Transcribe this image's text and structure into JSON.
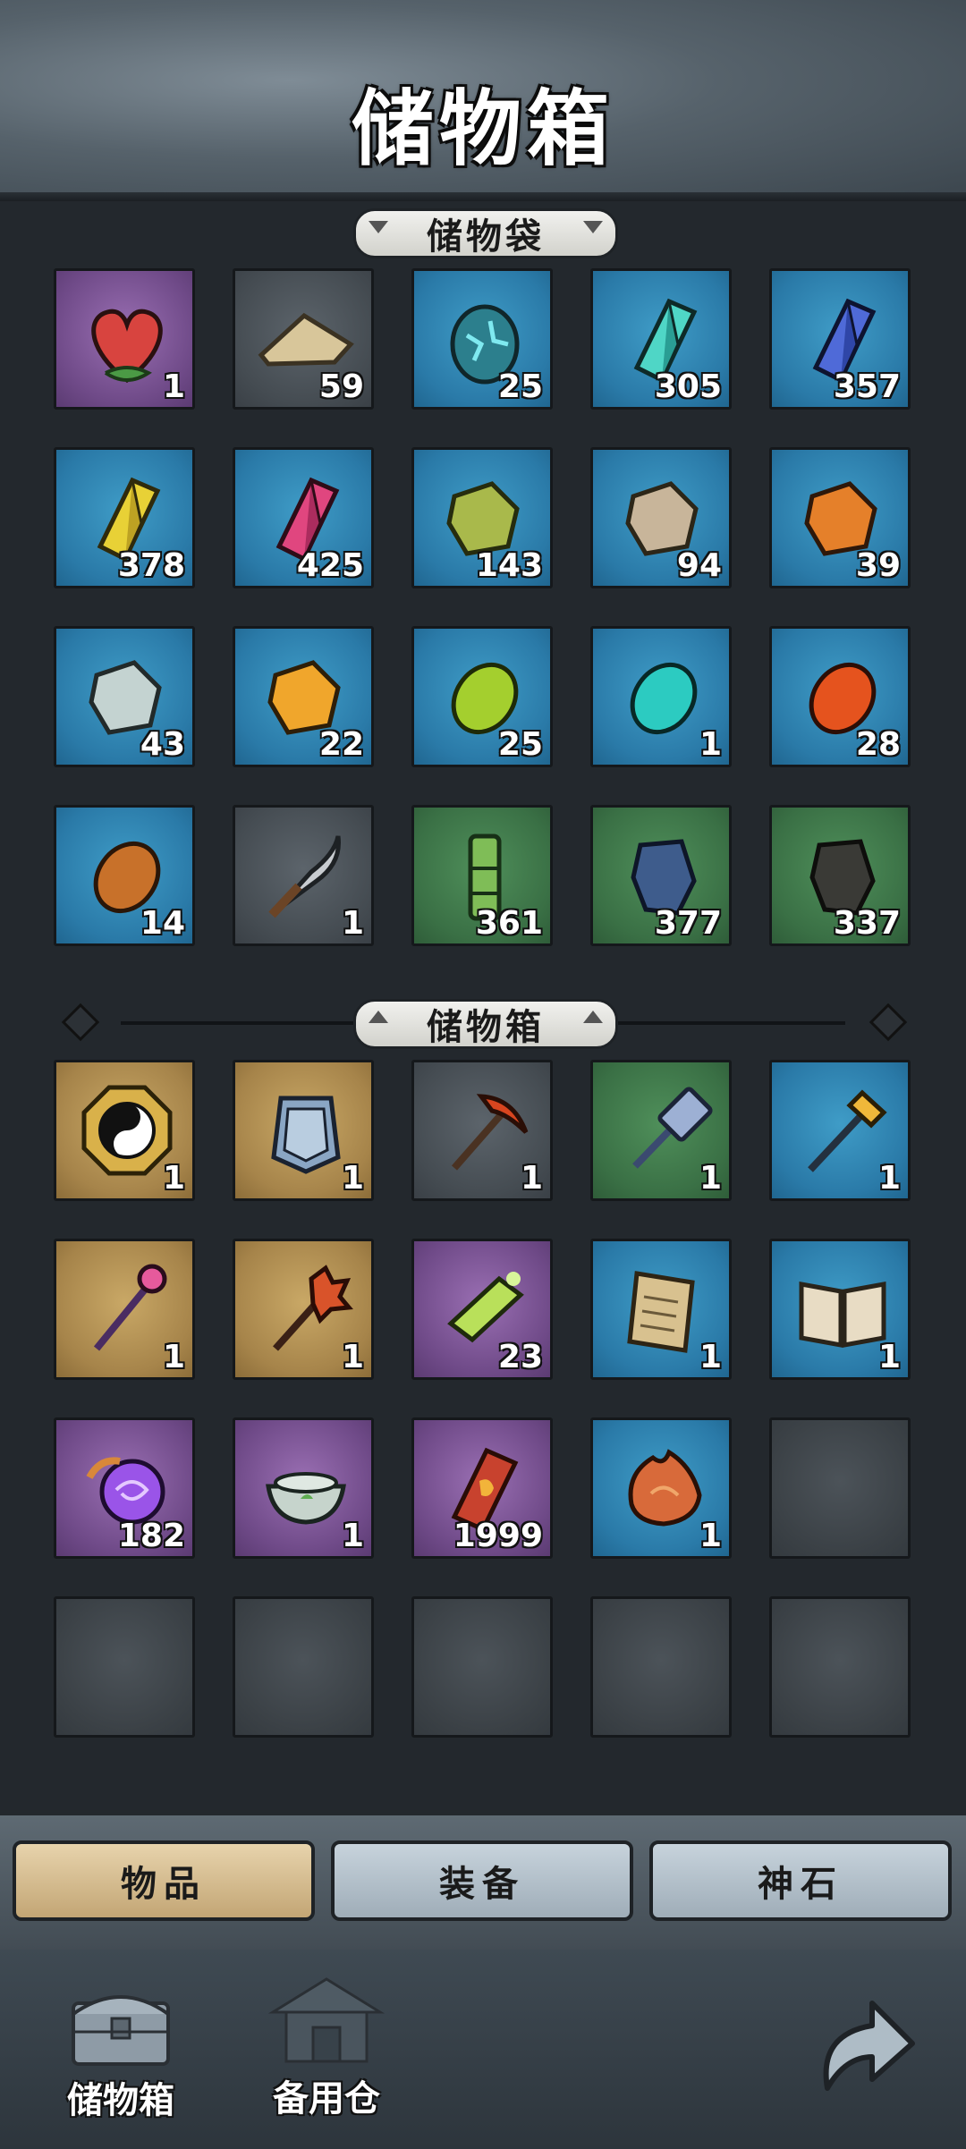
{
  "header": {
    "title": "储物箱"
  },
  "bag_section": {
    "title": "储物袋",
    "items": [
      {
        "icon": "heart-fruit-icon",
        "rarity": "purple",
        "count": "1"
      },
      {
        "icon": "sand-pile-icon",
        "rarity": "gray",
        "count": "59"
      },
      {
        "icon": "cracked-gem-icon",
        "rarity": "blue",
        "count": "25"
      },
      {
        "icon": "cyan-crystal-icon",
        "rarity": "blue",
        "count": "305"
      },
      {
        "icon": "blue-crystal-icon",
        "rarity": "blue",
        "count": "357"
      },
      {
        "icon": "yellow-crystal-icon",
        "rarity": "blue",
        "count": "378"
      },
      {
        "icon": "pink-crystal-icon",
        "rarity": "blue",
        "count": "425"
      },
      {
        "icon": "olive-ore-icon",
        "rarity": "blue",
        "count": "143"
      },
      {
        "icon": "beige-ore-icon",
        "rarity": "blue",
        "count": "94"
      },
      {
        "icon": "orange-ore-icon",
        "rarity": "blue",
        "count": "39"
      },
      {
        "icon": "white-ore-icon",
        "rarity": "blue",
        "count": "43"
      },
      {
        "icon": "amber-ore-icon",
        "rarity": "blue",
        "count": "22"
      },
      {
        "icon": "green-pebble-icon",
        "rarity": "blue",
        "count": "25"
      },
      {
        "icon": "teal-pebble-icon",
        "rarity": "blue",
        "count": "1"
      },
      {
        "icon": "red-pebble-icon",
        "rarity": "blue",
        "count": "28"
      },
      {
        "icon": "brown-pebble-icon",
        "rarity": "blue",
        "count": "14"
      },
      {
        "icon": "sickle-icon",
        "rarity": "gray",
        "count": "1"
      },
      {
        "icon": "bamboo-icon",
        "rarity": "green",
        "count": "361"
      },
      {
        "icon": "dark-blue-stone-icon",
        "rarity": "green",
        "count": "377"
      },
      {
        "icon": "black-stone-icon",
        "rarity": "green",
        "count": "337"
      }
    ]
  },
  "box_section": {
    "title": "储物箱",
    "items": [
      {
        "icon": "yin-yang-medallion-icon",
        "rarity": "gold",
        "count": "1"
      },
      {
        "icon": "armor-icon",
        "rarity": "gold",
        "count": "1"
      },
      {
        "icon": "pickaxe-icon",
        "rarity": "gray",
        "count": "1"
      },
      {
        "icon": "hammer-icon",
        "rarity": "green",
        "count": "1"
      },
      {
        "icon": "golden-mace-icon",
        "rarity": "blue",
        "count": "1"
      },
      {
        "icon": "staff-icon",
        "rarity": "gold",
        "count": "1"
      },
      {
        "icon": "fire-mace-icon",
        "rarity": "gold",
        "count": "1"
      },
      {
        "icon": "green-scroll-icon",
        "rarity": "purple",
        "count": "23"
      },
      {
        "icon": "parchment-icon",
        "rarity": "blue",
        "count": "1"
      },
      {
        "icon": "book-icon",
        "rarity": "blue",
        "count": "1"
      },
      {
        "icon": "purple-orb-icon",
        "rarity": "purple",
        "count": "182"
      },
      {
        "icon": "tea-bowl-icon",
        "rarity": "purple",
        "count": "1"
      },
      {
        "icon": "talisman-icon",
        "rarity": "purple",
        "count": "1999"
      },
      {
        "icon": "flame-pelt-icon",
        "rarity": "blue",
        "count": "1"
      },
      {
        "icon": "",
        "rarity": "empty",
        "count": ""
      },
      {
        "icon": "",
        "rarity": "empty",
        "count": ""
      },
      {
        "icon": "",
        "rarity": "empty",
        "count": ""
      },
      {
        "icon": "",
        "rarity": "empty",
        "count": ""
      },
      {
        "icon": "",
        "rarity": "empty",
        "count": ""
      },
      {
        "icon": "",
        "rarity": "empty",
        "count": ""
      }
    ]
  },
  "tabs": [
    {
      "label": "物品",
      "active": true
    },
    {
      "label": "装备",
      "active": false
    },
    {
      "label": "神石",
      "active": false
    }
  ],
  "nav": {
    "storage_label": "储物箱",
    "backup_label": "备用仓"
  }
}
